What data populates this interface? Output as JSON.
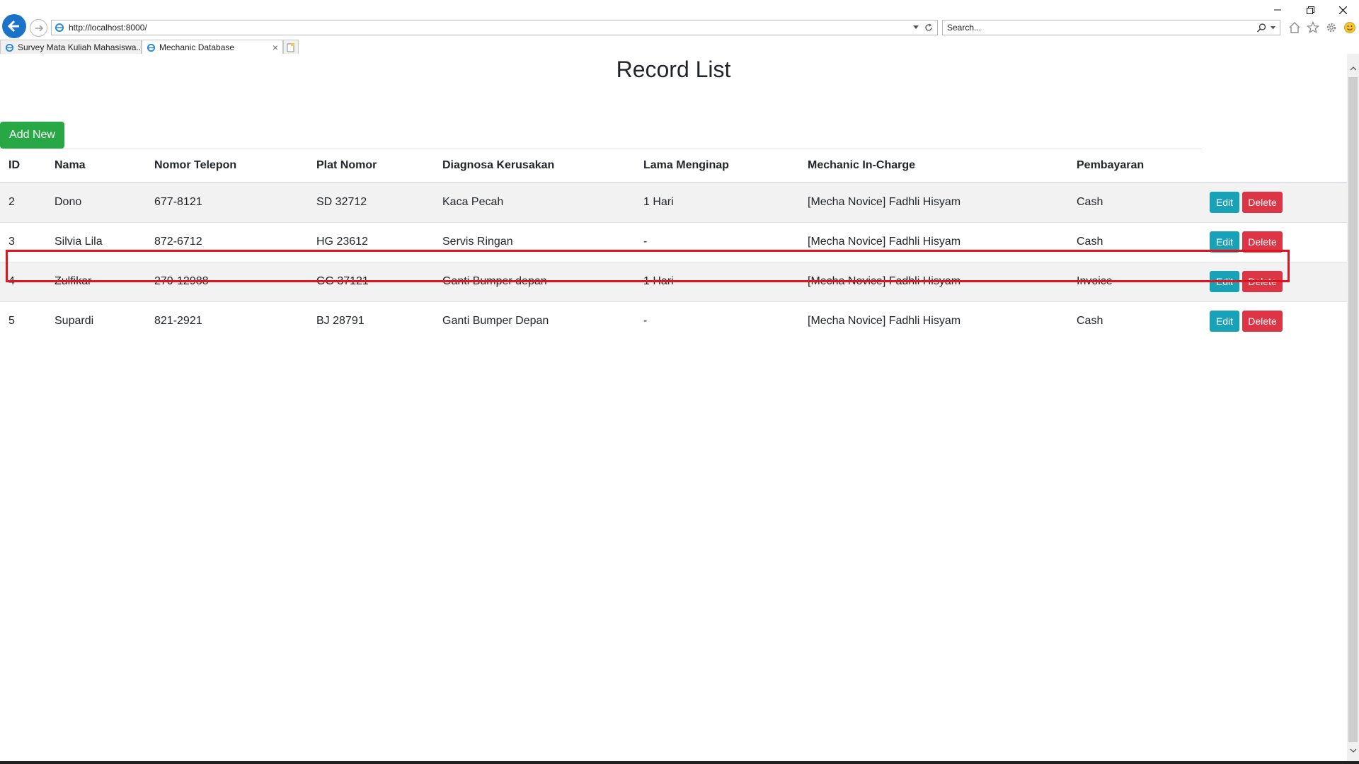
{
  "browser": {
    "url": "http://localhost:8000/",
    "search_placeholder": "Search...",
    "tabs": [
      {
        "label": "Survey Mata Kuliah Mahasiswa..."
      },
      {
        "label": "Mechanic Database"
      }
    ],
    "tab_close_glyph": "×"
  },
  "page": {
    "title": "Record List",
    "add_button": "Add New"
  },
  "table": {
    "columns": [
      "ID",
      "Nama",
      "Nomor Telepon",
      "Plat Nomor",
      "Diagnosa Kerusakan",
      "Lama Menginap",
      "Mechanic In-Charge",
      "Pembayaran"
    ],
    "rows": [
      {
        "id": "2",
        "nama": "Dono",
        "telepon": "677-8121",
        "plat": "SD 32712",
        "diagnosa": "Kaca Pecah",
        "lama": "1 Hari",
        "mechanic": "[Mecha Novice] Fadhli Hisyam",
        "pembayaran": "Cash"
      },
      {
        "id": "3",
        "nama": "Silvia Lila",
        "telepon": "872-6712",
        "plat": "HG 23612",
        "diagnosa": "Servis Ringan",
        "lama": "-",
        "mechanic": "[Mecha Novice] Fadhli Hisyam",
        "pembayaran": "Cash"
      },
      {
        "id": "4",
        "nama": "Zulfikar",
        "telepon": "270-12988",
        "plat": "GG 37121",
        "diagnosa": "Ganti Bumper depan",
        "lama": "1 Hari",
        "mechanic": "[Mecha Novice] Fadhli Hisyam",
        "pembayaran": "Invoice"
      },
      {
        "id": "5",
        "nama": "Supardi",
        "telepon": "821-2921",
        "plat": "BJ 28791",
        "diagnosa": "Ganti Bumper Depan",
        "lama": "-",
        "mechanic": "[Mecha Novice] Fadhli Hisyam",
        "pembayaran": "Cash"
      }
    ],
    "edit_label": "Edit",
    "delete_label": "Delete"
  },
  "colors": {
    "add_button": "#28a745",
    "edit_button": "#17a2b8",
    "delete_button": "#dc3545",
    "highlight": "#e0141e",
    "back_button": "#1a73c9"
  },
  "icons": [
    "back-arrow-icon",
    "forward-arrow-icon",
    "ie-page-icon",
    "dropdown-icon",
    "refresh-icon",
    "search-icon",
    "home-icon",
    "favorites-star-icon",
    "settings-gear-icon",
    "smiley-feedback-icon",
    "new-tab-icon",
    "minimize-icon",
    "restore-icon",
    "close-icon"
  ]
}
